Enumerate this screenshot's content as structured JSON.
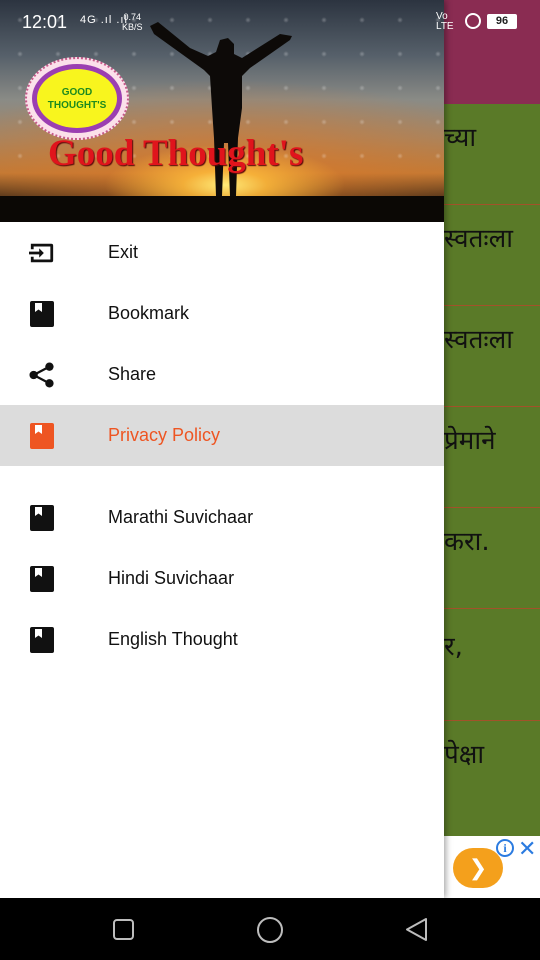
{
  "status_bar": {
    "time": "12:01",
    "signal": "4G .ıl .ıl",
    "speed_value": "0.74",
    "speed_unit": "KB/S",
    "volte": "Vo",
    "lte": "LTE",
    "battery": "96"
  },
  "background_app": {
    "rows": [
      "च्या",
      "स्वतःला",
      "स्वतःला",
      "प्रेमाने",
      "करा.",
      "र,",
      "पेक्षा"
    ]
  },
  "drawer": {
    "logo_text": "GOOD THOUGHT'S",
    "header_title": "Good Thought's",
    "items": [
      {
        "label": "Exit",
        "icon": "exit-icon"
      },
      {
        "label": "Bookmark",
        "icon": "bookmark-book-icon"
      },
      {
        "label": "Share",
        "icon": "share-icon"
      },
      {
        "label": "Privacy Policy",
        "icon": "bookmark-book-icon",
        "selected": true
      }
    ],
    "sections": [
      {
        "label": "Marathi Suvichaar",
        "icon": "bookmark-book-icon"
      },
      {
        "label": "Hindi Suvichaar",
        "icon": "bookmark-book-icon"
      },
      {
        "label": "English Thought",
        "icon": "bookmark-book-icon"
      }
    ]
  },
  "colors": {
    "accent": "#ee5522",
    "toolbar": "#8a2c52",
    "list_bg": "#5a7a28",
    "title_red": "#e0141c"
  },
  "nav_bar": {
    "buttons": [
      "recent-apps-icon",
      "home-icon",
      "back-icon"
    ]
  }
}
